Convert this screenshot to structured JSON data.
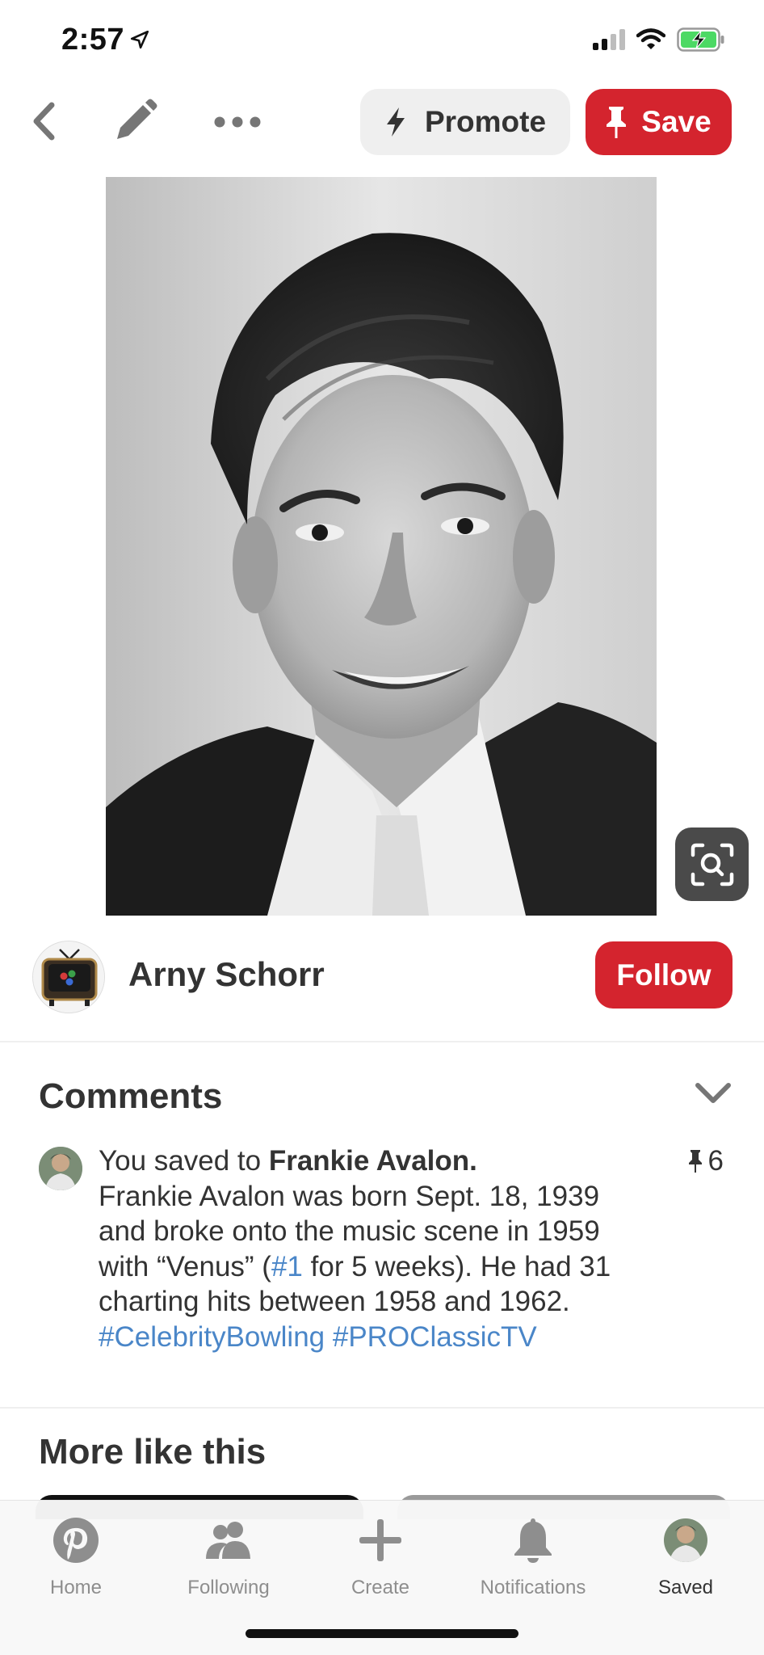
{
  "status_bar": {
    "time": "2:57"
  },
  "top_bar": {
    "promote_label": "Promote",
    "save_label": "Save"
  },
  "creator": {
    "name": "Arny Schorr",
    "follow_label": "Follow"
  },
  "comments": {
    "title": "Comments",
    "saved_prefix": "You saved to ",
    "board_name": "Frankie Avalon.",
    "description_part1": "Frankie Avalon was born Sept. 18, 1939 and broke onto the music scene in 1959 with “Venus” (",
    "hashtag_number": "#1",
    "description_part2": " for 5 weeks). He had 31 charting hits between 1958 and 1962. ",
    "hashtag_1": "#CelebrityBowling",
    "hashtag_2": "#PROClassicTV",
    "pin_count": "6"
  },
  "more": {
    "title": "More like this"
  },
  "tabs": [
    {
      "label": "Home",
      "icon": "pinterest-logo-icon"
    },
    {
      "label": "Following",
      "icon": "people-icon"
    },
    {
      "label": "Create",
      "icon": "plus-icon"
    },
    {
      "label": "Notifications",
      "icon": "bell-icon"
    },
    {
      "label": "Saved",
      "icon": "profile-avatar"
    }
  ],
  "colors": {
    "brand_red": "#d4242e",
    "link_blue": "#4a86c8",
    "battery_green": "#4cd964"
  }
}
